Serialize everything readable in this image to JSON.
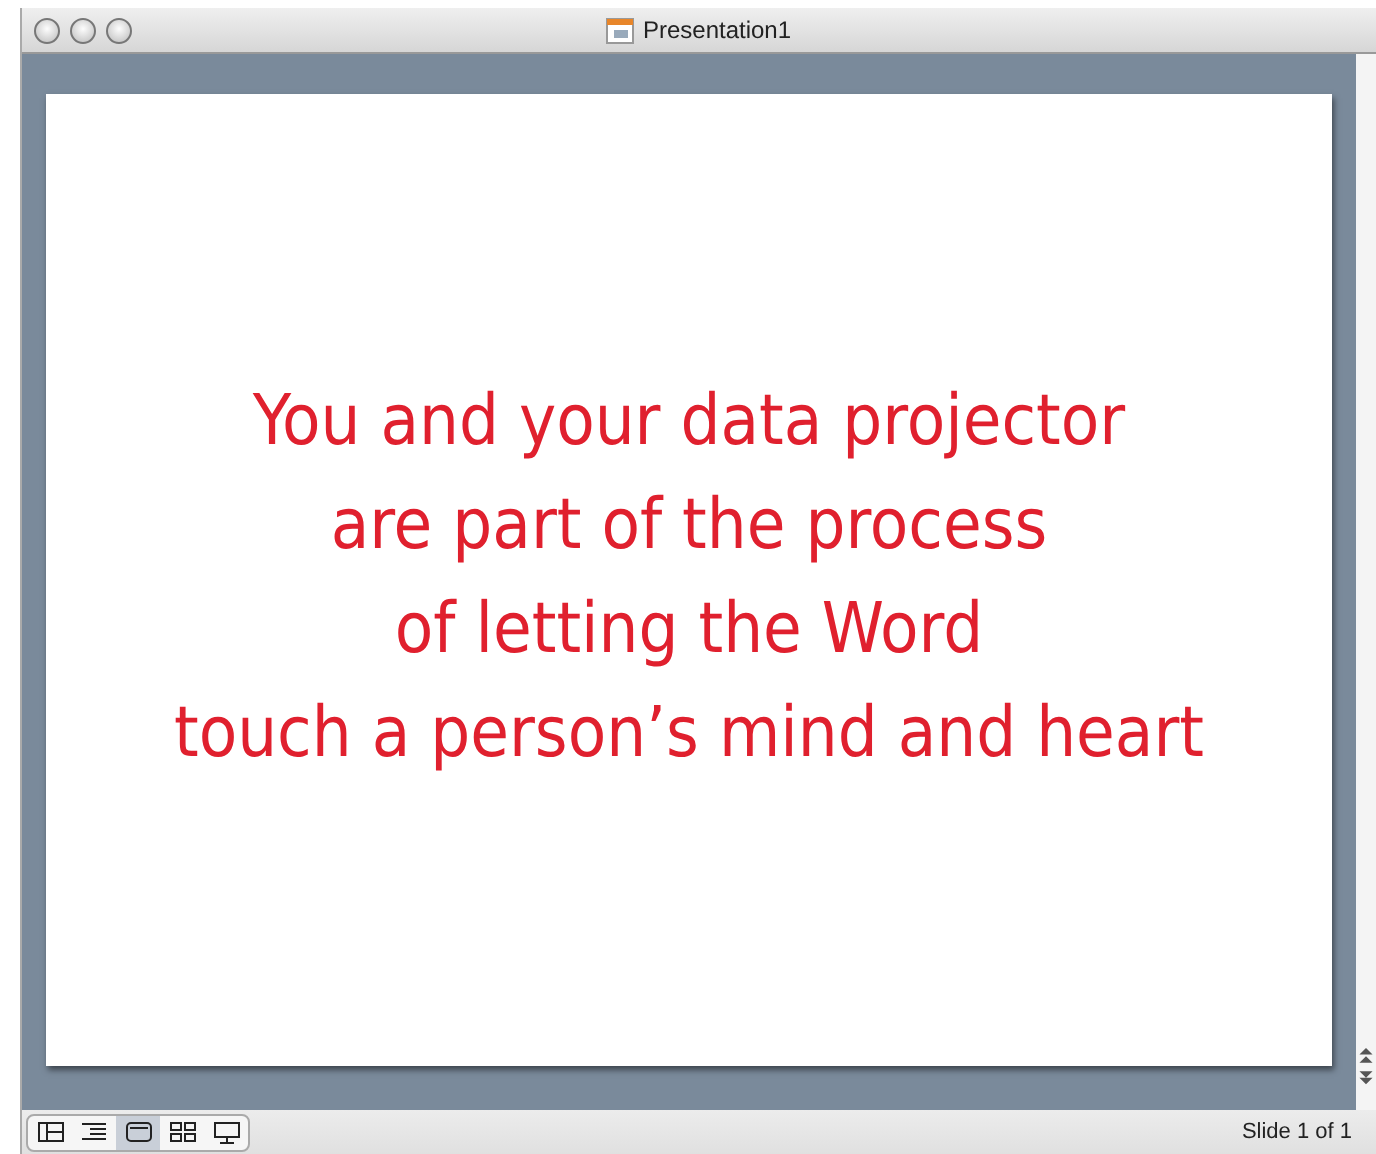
{
  "window": {
    "title": "Presentation1"
  },
  "slide": {
    "lines": [
      "You and your data projector",
      "are part of the process",
      "of letting the Word",
      "touch a person’s mind and heart"
    ]
  },
  "view_buttons": [
    {
      "kind": "normal",
      "selected": false
    },
    {
      "kind": "outline",
      "selected": false
    },
    {
      "kind": "slide",
      "selected": true
    },
    {
      "kind": "sorter",
      "selected": false
    },
    {
      "kind": "show",
      "selected": false
    }
  ],
  "status_bar": {
    "text": "Slide 1 of 1"
  }
}
